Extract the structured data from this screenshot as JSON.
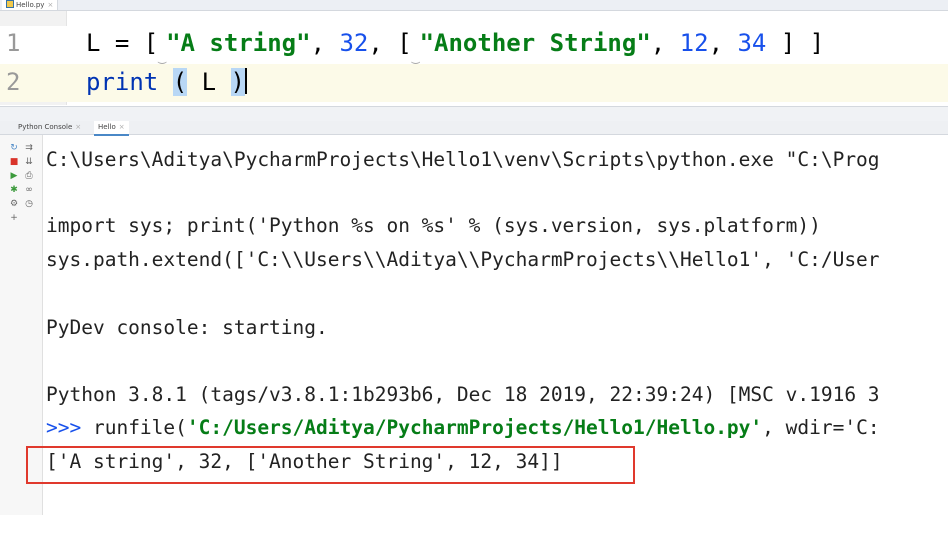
{
  "editor": {
    "tab_label": "Hello.py",
    "line_numbers": [
      "1",
      "2"
    ],
    "line1": {
      "p1": "L = [",
      "s1": "\"A string\"",
      "p2": ", ",
      "n1": "32",
      "p3": ", [",
      "s2": "\"Another String\"",
      "p4": ", ",
      "n2": "12",
      "p5": ", ",
      "n3": "34",
      "p6": " ] ]"
    },
    "line2": {
      "fn": "print",
      "p1": " ",
      "paren_open": "(",
      "arg": " L ",
      "paren_close": ")"
    }
  },
  "console_tabs": [
    "Python Console",
    "Hello"
  ],
  "console": {
    "line1": "C:\\Users\\Aditya\\PycharmProjects\\Hello1\\venv\\Scripts\\python.exe \"C:\\Prog",
    "line2": "import sys; print('Python %s on %s' % (sys.version, sys.platform))",
    "line3": "sys.path.extend(['C:\\\\Users\\\\Aditya\\\\PycharmProjects\\\\Hello1', 'C:/User",
    "line4": "PyDev console: starting.",
    "line5": "Python 3.8.1 (tags/v3.8.1:1b293b6, Dec 18 2019, 22:39:24) [MSC v.1916 3",
    "line6_prompt": ">>> ",
    "line6_call": "runfile(",
    "line6_path": "'C:/Users/Aditya/PycharmProjects/Hello1/Hello.py'",
    "line6_rest": ", wdir='C:",
    "result": "['A string', 32, ['Another String', 12, 34]]"
  },
  "colors": {
    "highlight_box": "#e0392d",
    "string": "#067d17",
    "number": "#1750eb",
    "bracket_highlight": "#b8d7f5"
  }
}
